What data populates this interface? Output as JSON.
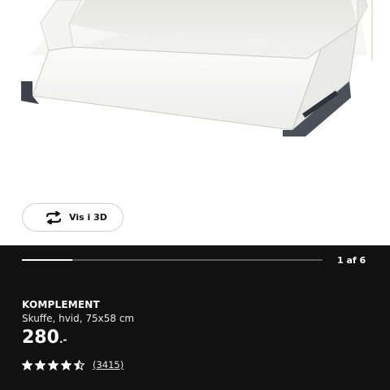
{
  "product_image": {
    "description_icon": "drawer-product-image"
  },
  "view3d": {
    "label": "Vis i 3D",
    "icon": "rotate-3d-icon"
  },
  "gallery": {
    "pager_text": "1 af 6",
    "progress": 0.167
  },
  "product": {
    "name": "KOMPLEMENT",
    "description": "Skuffe, hvid, 75x58 cm",
    "price_main": "280",
    "price_suffix": ".-",
    "rating": {
      "value": 4.5,
      "max": 5,
      "count_text": "(3415)"
    }
  },
  "colors": {
    "info_bg": "#111111",
    "accent": "#ffffff",
    "track": "#5a5a5a"
  }
}
